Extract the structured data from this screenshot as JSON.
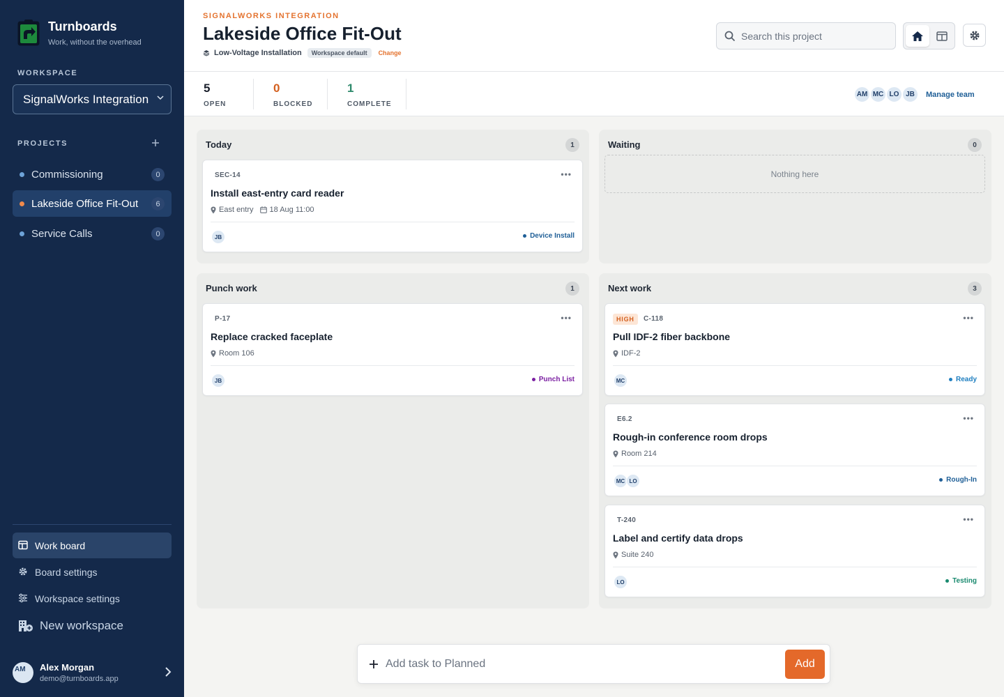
{
  "brand": {
    "name": "Turnboards",
    "tagline": "Work, without the overhead"
  },
  "sidebar": {
    "workspace_heading": "WORKSPACE",
    "workspace_selected": "SignalWorks Integration",
    "projects_heading": "PROJECTS",
    "projects": [
      {
        "label": "Commissioning",
        "count": "0",
        "active": false
      },
      {
        "label": "Lakeside Office Fit-Out",
        "count": "6",
        "active": true
      },
      {
        "label": "Service Calls",
        "count": "0",
        "active": false
      }
    ],
    "nav": [
      {
        "label": "Work board",
        "icon": "board-icon",
        "active": true
      },
      {
        "label": "Board settings",
        "icon": "gear-icon",
        "active": false
      },
      {
        "label": "Workspace settings",
        "icon": "sliders-icon",
        "active": false
      },
      {
        "label": "New workspace",
        "icon": "building-plus-icon",
        "active": false
      }
    ],
    "user": {
      "initials": "AM",
      "name": "Alex Morgan",
      "email": "demo@turnboards.app"
    }
  },
  "header": {
    "eyebrow": "SIGNALWORKS INTEGRATION",
    "title": "Lakeside Office Fit-Out",
    "board_type": "Low-Voltage Installation",
    "board_type_badge": "Workspace default",
    "change_label": "Change",
    "search_placeholder": "Search this project"
  },
  "stats": [
    {
      "value": "5",
      "label": "OPEN",
      "color": "#1a1f2b"
    },
    {
      "value": "0",
      "label": "BLOCKED",
      "color": "#d35f1e"
    },
    {
      "value": "1",
      "label": "COMPLETE",
      "color": "#2f8a6c"
    }
  ],
  "team": {
    "members": [
      "AM",
      "MC",
      "LO",
      "JB"
    ],
    "manage_label": "Manage team"
  },
  "columns": {
    "today": {
      "title": "Today",
      "count": "1",
      "cards": [
        {
          "id": "SEC-14",
          "title": "Install east-entry card reader",
          "location": "East entry",
          "date": "18 Aug 11:00",
          "assignees": [
            "JB"
          ],
          "tag": "Device Install",
          "tag_color": "#1f5f97"
        }
      ]
    },
    "waiting": {
      "title": "Waiting",
      "count": "0",
      "empty_text": "Nothing here"
    },
    "punch": {
      "title": "Punch work",
      "count": "1",
      "cards": [
        {
          "id": "P-17",
          "title": "Replace cracked faceplate",
          "location": "Room 106",
          "assignees": [
            "JB"
          ],
          "tag": "Punch List",
          "tag_color": "#7b1fa2"
        }
      ]
    },
    "next": {
      "title": "Next work",
      "count": "3",
      "cards": [
        {
          "priority": "HIGH",
          "id": "C-118",
          "title": "Pull IDF-2 fiber backbone",
          "location": "IDF-2",
          "assignees": [
            "MC"
          ],
          "tag": "Ready",
          "tag_color": "#1f7fc0"
        },
        {
          "id": "E6.2",
          "title": "Rough-in conference room drops",
          "location": "Room 214",
          "assignees": [
            "MC",
            "LO"
          ],
          "tag": "Rough-In",
          "tag_color": "#1f5f97"
        },
        {
          "id": "T-240",
          "title": "Label and certify data drops",
          "location": "Suite 240",
          "assignees": [
            "LO"
          ],
          "tag": "Testing",
          "tag_color": "#1a8a6f"
        }
      ]
    }
  },
  "card_menu_glyph": "•••",
  "add_bar": {
    "placeholder": "Add task to Planned",
    "button": "Add"
  },
  "colors": {
    "sidebar": "#14294a",
    "accent": "#e4692a",
    "link": "#1f5f97"
  }
}
